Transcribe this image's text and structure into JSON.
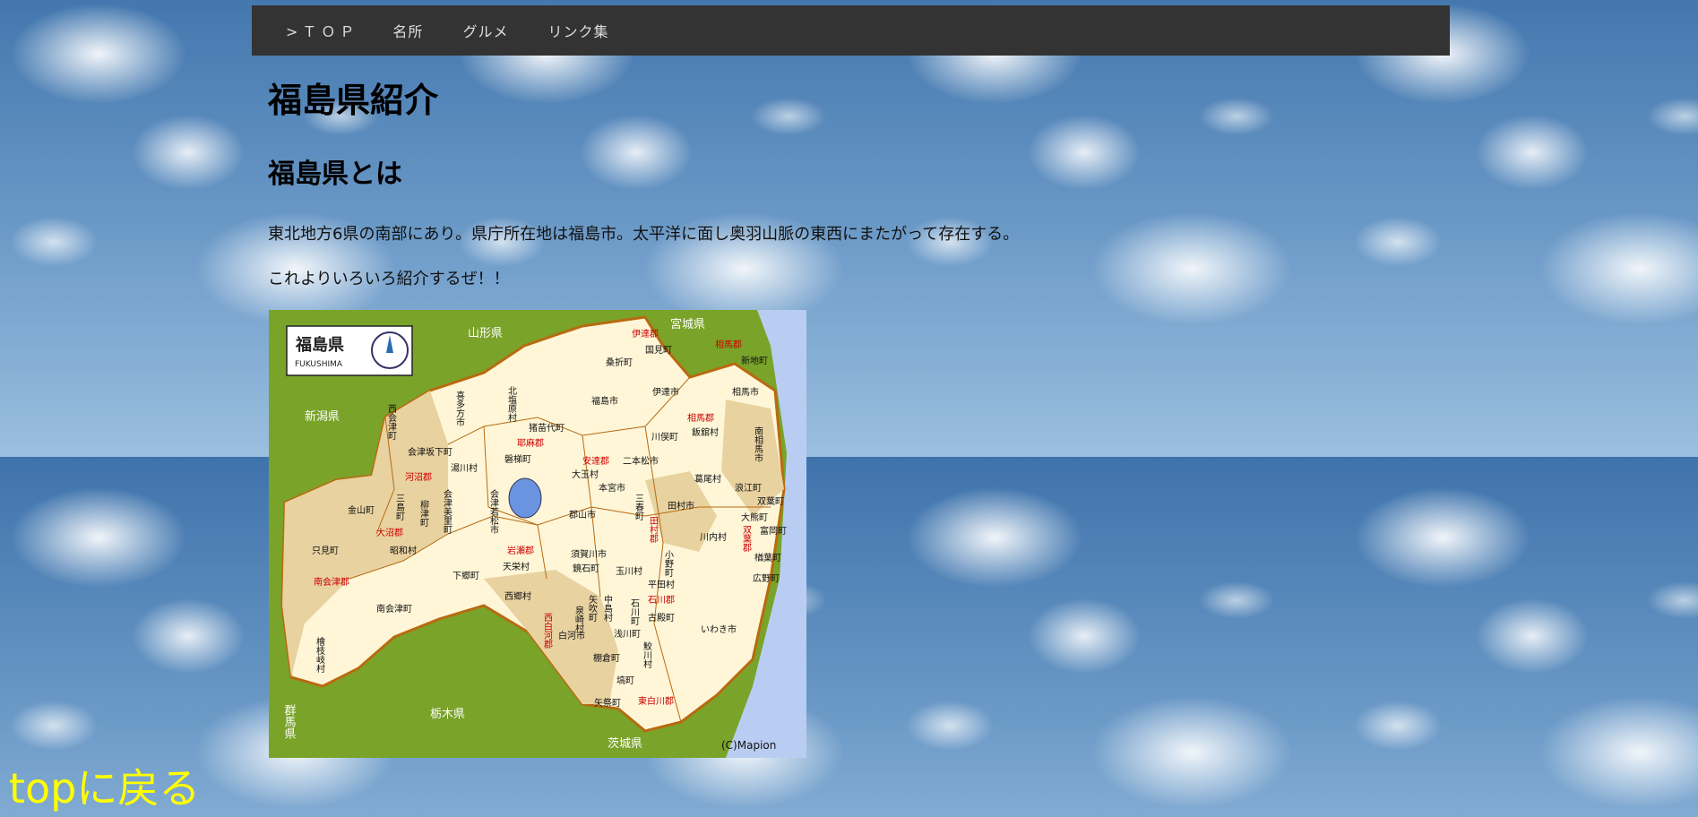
{
  "nav": {
    "items": [
      ">ＴＯＰ",
      "名所",
      "グルメ",
      "リンク集"
    ]
  },
  "page": {
    "title": "福島県紹介",
    "section_title": "福島県とは",
    "paragraph1": "東北地方6県の南部にあり。県庁所在地は福島市。太平洋に面し奥羽山脈の東西にまたがって存在する。",
    "paragraph2": "これよりいろいろ紹介するぜ！！"
  },
  "map": {
    "logo_kanji": "福島県",
    "logo_roman": "FUKUSHIMA",
    "neighbors": {
      "yamagata": "山形県",
      "miyagi": "宮城県",
      "niigata": "新潟県",
      "gunma": "群馬県",
      "tochigi": "栃木県",
      "ibaraki": "茨城県"
    },
    "labels": [
      {
        "t": "伊達郡",
        "red": true
      },
      {
        "t": "相馬郡",
        "red": true
      },
      {
        "t": "国見町",
        "red": false
      },
      {
        "t": "桑折町",
        "red": false
      },
      {
        "t": "新地町",
        "red": false
      },
      {
        "t": "福島市",
        "red": false
      },
      {
        "t": "伊達市",
        "red": false
      },
      {
        "t": "相馬市",
        "red": false
      },
      {
        "t": "相馬郡",
        "red": true
      },
      {
        "t": "川俣町",
        "red": false
      },
      {
        "t": "飯舘村",
        "red": false
      },
      {
        "t": "耶麻郡",
        "red": true
      },
      {
        "t": "会津坂下町",
        "red": false
      },
      {
        "t": "猪苗代町",
        "red": false
      },
      {
        "t": "河沼郡",
        "red": true
      },
      {
        "t": "湯川村",
        "red": false
      },
      {
        "t": "磐梯町",
        "red": false
      },
      {
        "t": "安達郡",
        "red": true
      },
      {
        "t": "二本松市",
        "red": false
      },
      {
        "t": "大玉村",
        "red": false
      },
      {
        "t": "本宮市",
        "red": false
      },
      {
        "t": "葛尾村",
        "red": false
      },
      {
        "t": "浪江町",
        "red": false
      },
      {
        "t": "双葉町",
        "red": false
      },
      {
        "t": "金山町",
        "red": false
      },
      {
        "t": "郡山市",
        "red": false
      },
      {
        "t": "田村市",
        "red": false
      },
      {
        "t": "大沼郡",
        "red": true
      },
      {
        "t": "昭和村",
        "red": false
      },
      {
        "t": "大熊町",
        "red": false
      },
      {
        "t": "川内村",
        "red": false
      },
      {
        "t": "富岡町",
        "red": false
      },
      {
        "t": "只見町",
        "red": false
      },
      {
        "t": "岩瀬郡",
        "red": true
      },
      {
        "t": "須賀川市",
        "red": false
      },
      {
        "t": "天栄村",
        "red": false
      },
      {
        "t": "鏡石町",
        "red": false
      },
      {
        "t": "玉川村",
        "red": false
      },
      {
        "t": "楢葉町",
        "red": false
      },
      {
        "t": "下郷町",
        "red": false
      },
      {
        "t": "南会津郡",
        "red": true
      },
      {
        "t": "平田村",
        "red": false
      },
      {
        "t": "広野町",
        "red": false
      },
      {
        "t": "西郷村",
        "red": false
      },
      {
        "t": "石川郡",
        "red": true
      },
      {
        "t": "南会津町",
        "red": false
      },
      {
        "t": "古殿町",
        "red": false
      },
      {
        "t": "白河市",
        "red": false
      },
      {
        "t": "浅川町",
        "red": false
      },
      {
        "t": "いわき市",
        "red": false
      },
      {
        "t": "棚倉町",
        "red": false
      },
      {
        "t": "塙町",
        "red": false
      },
      {
        "t": "矢祭町",
        "red": false
      },
      {
        "t": "東白川郡",
        "red": true
      },
      {
        "t": "西会津町",
        "red": false
      },
      {
        "t": "喜多方市",
        "red": false
      },
      {
        "t": "北塩原村",
        "red": false
      },
      {
        "t": "三島町",
        "red": false
      },
      {
        "t": "柳津町",
        "red": false
      },
      {
        "t": "会津美里町",
        "red": false
      },
      {
        "t": "会津若松市",
        "red": false
      },
      {
        "t": "三春町",
        "red": false
      },
      {
        "t": "田村郡",
        "red": true
      },
      {
        "t": "小野町",
        "red": false
      },
      {
        "t": "双葉郡",
        "red": true
      },
      {
        "t": "南相馬市",
        "red": false
      },
      {
        "t": "檜枝岐村",
        "red": false
      },
      {
        "t": "西白河郡",
        "red": true
      },
      {
        "t": "泉崎村",
        "red": false
      },
      {
        "t": "矢吹町",
        "red": false
      },
      {
        "t": "中島村",
        "red": false
      },
      {
        "t": "石川町",
        "red": false
      },
      {
        "t": "鮫川村",
        "red": false
      }
    ],
    "copyright": "(C)Mapion"
  },
  "footer": {
    "top_link": "topに戻る"
  },
  "colors": {
    "nav_bg": "#333333",
    "link_yellow": "#ffff00",
    "map_green": "#7aa32a",
    "map_land": "#fff6d8",
    "map_district": "#e8d2a0",
    "map_border": "#b86a10",
    "sea": "#b9cdf2"
  }
}
